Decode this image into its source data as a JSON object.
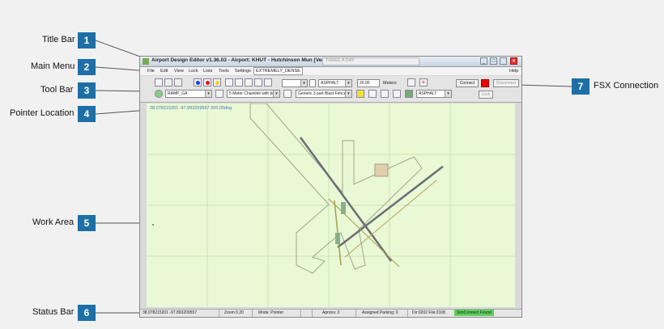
{
  "callouts": [
    {
      "num": "1",
      "label": "Title Bar"
    },
    {
      "num": "2",
      "label": "Main Menu"
    },
    {
      "num": "3",
      "label": "Tool Bar"
    },
    {
      "num": "4",
      "label": "Pointer Location"
    },
    {
      "num": "5",
      "label": "Work Area"
    },
    {
      "num": "6",
      "label": "Status Bar"
    },
    {
      "num": "7",
      "label": "FSX Connection"
    }
  ],
  "window": {
    "title": "Airport Design Editor  v1.36.03  -  Airport: KHUT - Hutchinson Mun [Ver. C",
    "second_tab": "THREE A DAY",
    "controls": [
      "_",
      "□",
      "✕"
    ]
  },
  "menu": {
    "items": [
      "File",
      "Edit",
      "View",
      "Lock",
      "Lists",
      "Tools",
      "Settings"
    ],
    "density": "EXTREMELY_DENSE",
    "help": "Help"
  },
  "toolbar": {
    "surface1": "ASPHALT",
    "width_value": "20.00",
    "unit": "Meters",
    "apron_type": "RAMP_GA",
    "fence1": "5 Meter Chainlink with be",
    "fence2": "Generic 3 part Blast Fence",
    "surface2": "ASPHALT",
    "connect": "Connect",
    "disconnect": "Disconnect",
    "lock": "Lock"
  },
  "pointer": {
    "location": "38.078215201  -97.893209557 000.00deg"
  },
  "status": {
    "coords": "38.078215201  -97.893209557",
    "zoom": "Zoom 0.20",
    "mode": "Mode: Pointer",
    "aprons": "Aprons: 2",
    "parking": "Assigned Parking: 0",
    "dir": "Dir:0202  File:2108",
    "simconnect": "SimConnect Found"
  },
  "colors": {
    "callout_box": "#1d6fa5",
    "work_area": "#e9f8d5",
    "simconnect_ok": "#5ad15a"
  }
}
